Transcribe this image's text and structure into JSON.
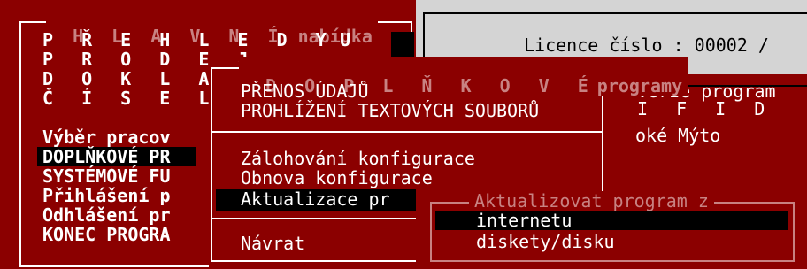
{
  "main_menu": {
    "title_letters": "H L A V N Í",
    "title_word": "nabídka",
    "items": [
      "P Ř E H L E D Y",
      "P R O D E J",
      "D O K L A D",
      "Č Í S E L N",
      "Výběr pracov",
      "DOPLŇKOVÉ PR",
      "SYSTÉMOVÉ FU",
      "Přihlášení p",
      "Odhlášení pr",
      "KONEC PROGRA"
    ],
    "selected_index": 5,
    "right_char": "U"
  },
  "info_panel": {
    "license": "Licence číslo : 00002 /",
    "version": "verze program",
    "code": "I F I D",
    "place": "oké Mýto"
  },
  "sub_menu": {
    "title_letters": "D O P L Ň K O V É",
    "title_word": "programy",
    "items": [
      "PŘENOS ÚDAJŮ",
      "PROHLÍŽENÍ TEXTOVÝCH SOUBORŮ",
      "Zálohování konfigurace",
      "Obnova konfigurace",
      "Aktualizace pr",
      "Návrat"
    ],
    "selected_index": 4
  },
  "update_menu": {
    "title": "Aktualizovat program z",
    "items": [
      "internetu",
      "diskety/disku"
    ],
    "selected_index": 0
  },
  "colors": {
    "window_bg": "#8b0000",
    "panel_bg": "#d4d4d4",
    "selection_bg": "#000000",
    "dim_text": "#c88282"
  }
}
